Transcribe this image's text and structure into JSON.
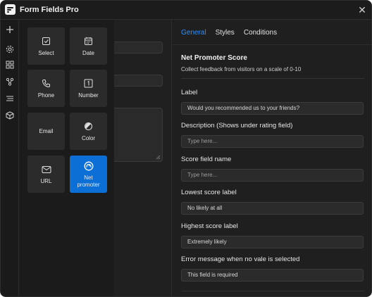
{
  "app": {
    "title": "Form Fields Pro",
    "close_glyph": "✕"
  },
  "rail": {
    "icons": [
      "plus-icon",
      "gear-icon",
      "blocks-icon",
      "share-nodes-icon",
      "list-icon",
      "cube-icon"
    ]
  },
  "field_types": [
    {
      "label": "Select",
      "icon": "checkbox-icon",
      "active": false
    },
    {
      "label": "Date",
      "icon": "calendar-icon",
      "active": false
    },
    {
      "label": "Phone",
      "icon": "phone-icon",
      "active": false
    },
    {
      "label": "Number",
      "icon": "number-one-icon",
      "active": false
    },
    {
      "label": "Email",
      "icon": "email-icon",
      "active": false
    },
    {
      "label": "Color",
      "icon": "color-icon",
      "active": false
    },
    {
      "label": "URL",
      "icon": "envelope-icon",
      "active": false
    },
    {
      "label": "Net\npromoter",
      "icon": "gauge-icon",
      "active": true
    }
  ],
  "panel": {
    "tabs": [
      {
        "label": "General",
        "active": true
      },
      {
        "label": "Styles",
        "active": false
      },
      {
        "label": "Conditions",
        "active": false
      }
    ],
    "section_title": "Net Promoter Score",
    "section_description": "Collect feedback from visitors on a scale of 0-10",
    "fields": [
      {
        "label": "Label",
        "value": "Would you recommended us to your friends?",
        "placeholder": ""
      },
      {
        "label": "Description (Shows under rating field)",
        "value": "",
        "placeholder": "Type here..."
      },
      {
        "label": "Score field name",
        "value": "",
        "placeholder": "Type here..."
      },
      {
        "label": "Lowest score label",
        "value": "No likely at all",
        "placeholder": ""
      },
      {
        "label": "Highest score label",
        "value": "Extremely likely",
        "placeholder": ""
      },
      {
        "label": "Error message when no vale is selected",
        "value": "This field is required",
        "placeholder": ""
      }
    ]
  },
  "colors": {
    "accent": "#2d8fff",
    "active_tile": "#0b6fd6",
    "window_bg": "#1e1e1e"
  }
}
